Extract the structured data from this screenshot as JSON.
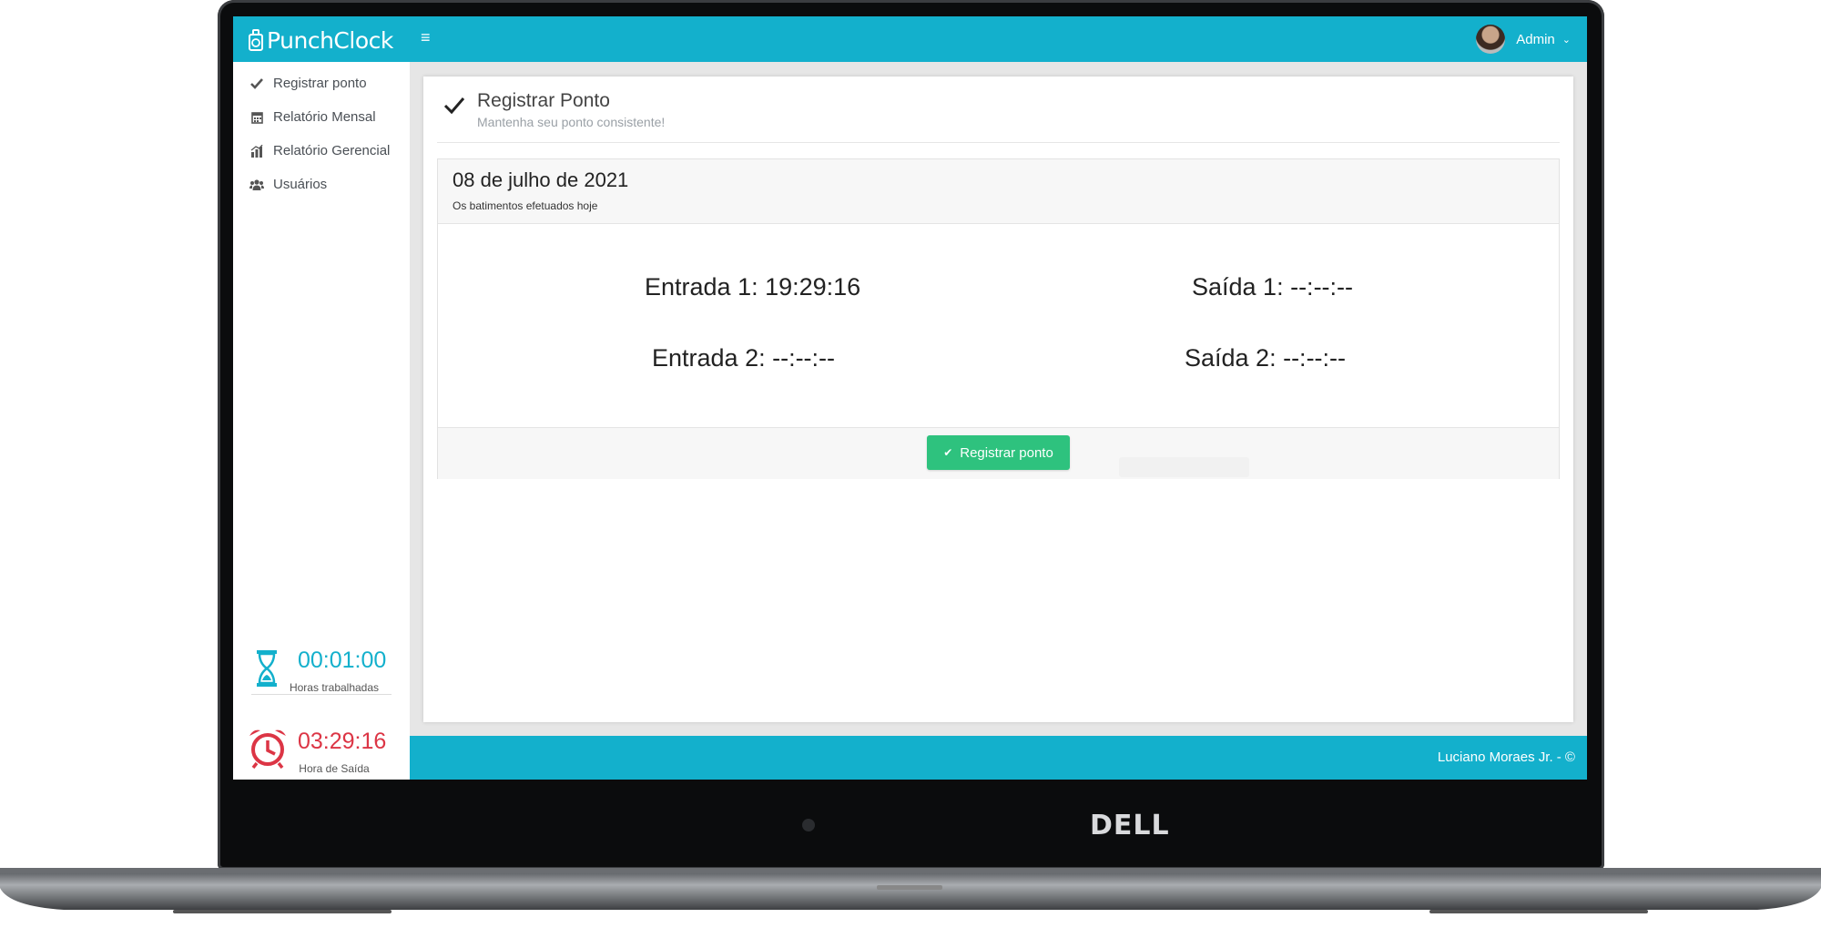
{
  "brand": {
    "logo_text": "PunchClock",
    "device_label": "DELL"
  },
  "header": {
    "menu_icon": "hamburger-icon",
    "user_name": "Admin"
  },
  "sidebar": {
    "items": [
      {
        "label": "Registrar ponto",
        "icon": "check-icon"
      },
      {
        "label": "Relatório Mensal",
        "icon": "calendar-icon"
      },
      {
        "label": "Relatório Gerencial",
        "icon": "chart-icon"
      },
      {
        "label": "Usuários",
        "icon": "users-icon"
      }
    ],
    "worked": {
      "value": "00:01:00",
      "label": "Horas trabalhadas",
      "color": "#13b0cc"
    },
    "exit": {
      "value": "03:29:16",
      "label": "Hora de Saída",
      "color": "#dc3545"
    }
  },
  "page": {
    "title": "Registrar Ponto",
    "subtitle": "Mantenha seu ponto consistente!"
  },
  "card": {
    "date": "08 de julho de 2021",
    "subtitle": "Os batimentos efetuados hoje",
    "entries": {
      "entrada1": "Entrada 1: 19:29:16",
      "saida1": "Saída 1: --:--:--",
      "entrada2": "Entrada 2: --:--:--",
      "saida2": "Saída 2: --:--:--"
    },
    "button_label": "Registrar ponto"
  },
  "footer": {
    "text": "Luciano Moraes Jr. - ©"
  },
  "colors": {
    "topbar": "#13b0cc",
    "button": "#2ec27e"
  }
}
